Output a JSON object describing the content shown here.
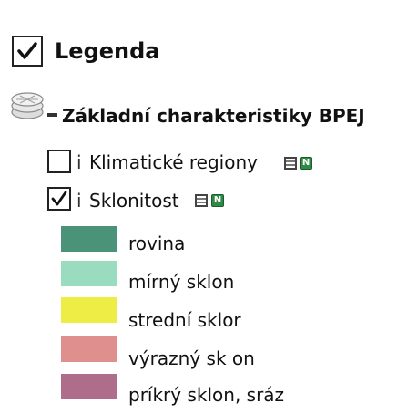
{
  "legend": {
    "title": "Legenda",
    "checked": true
  },
  "group": {
    "title": "Základní charakteristiky BPEJ",
    "icon": "layers-icon",
    "state_icon": "collapse-icon"
  },
  "layers": [
    {
      "label": "Klimatické regiony",
      "checked": false,
      "info_text": "i",
      "icons": [
        "table-icon",
        "n-icon"
      ]
    },
    {
      "label": "Sklonitost",
      "checked": true,
      "info_text": "i",
      "icons": [
        "table-icon",
        "n-icon"
      ]
    }
  ],
  "n_icon_text": "N",
  "legend_items": [
    {
      "label": "rovina",
      "color": "#4a9278"
    },
    {
      "label": "mírný sklon",
      "color": "#99dcc0"
    },
    {
      "label": "strední sklor",
      "color": "#eeed45"
    },
    {
      "label": "výrazný sk on",
      "color": "#e08f8f"
    },
    {
      "label": "príkrý sklon, sráz",
      "color": "#ae6e8b"
    }
  ]
}
